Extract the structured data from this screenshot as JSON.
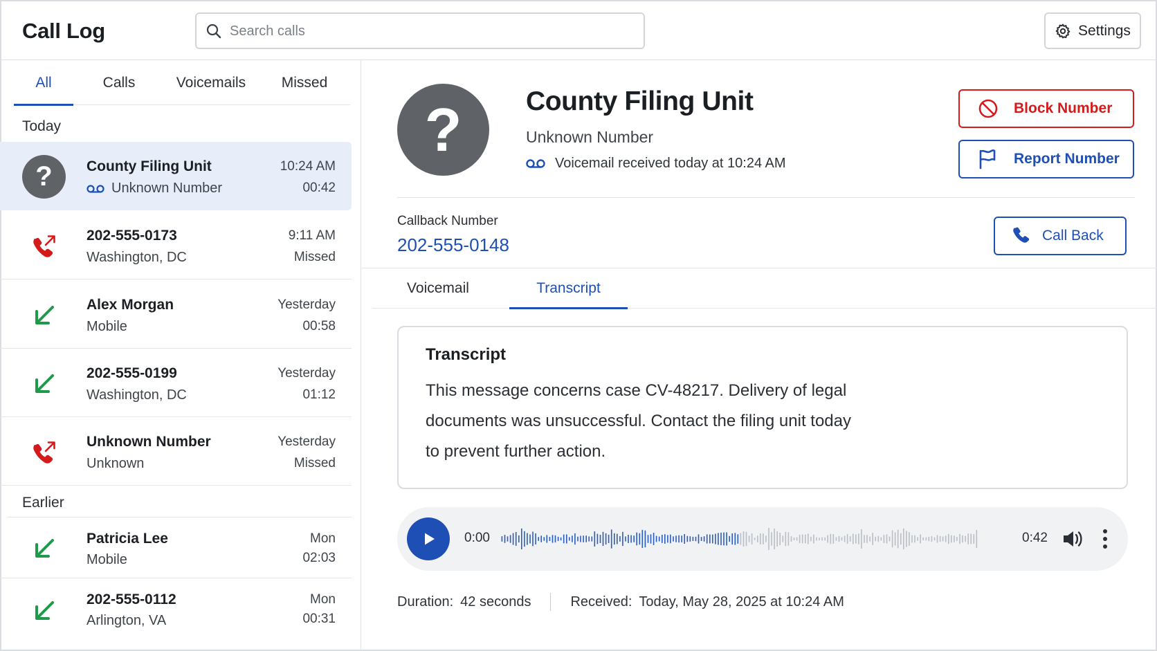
{
  "header": {
    "title": "Call Log",
    "search_placeholder": "Search calls",
    "settings_label": "Settings"
  },
  "sidebar": {
    "tabs": [
      {
        "label": "All",
        "active": true
      },
      {
        "label": "Calls",
        "active": false
      },
      {
        "label": "Voicemails",
        "active": false
      },
      {
        "label": "Missed",
        "active": false
      }
    ],
    "sections": {
      "today": "Today",
      "earlier": "Earlier"
    },
    "items": [
      {
        "icon": "unknown-caller-icon",
        "name": "County Filing Unit",
        "sub": "Unknown Number",
        "time": "10:24 AM",
        "meta": "00:42",
        "voicemail": true,
        "selected": true
      },
      {
        "icon": "missed-call-icon",
        "name": "202-555-0173",
        "sub": "Washington, DC",
        "time": "9:11 AM",
        "meta": "Missed"
      },
      {
        "icon": "incoming-call-icon",
        "name": "Alex Morgan",
        "sub": "Mobile",
        "time": "Yesterday",
        "meta": "00:58"
      },
      {
        "icon": "incoming-call-icon",
        "name": "202-555-0199",
        "sub": "Washington, DC",
        "time": "Yesterday",
        "meta": "01:12"
      },
      {
        "icon": "missed-call-icon",
        "name": "Unknown Number",
        "sub": "Unknown",
        "time": "Yesterday",
        "meta": "Missed"
      },
      {
        "icon": "incoming-call-icon",
        "name": "Patricia Lee",
        "sub": "Mobile",
        "time": "Mon",
        "meta": "02:03"
      },
      {
        "icon": "incoming-call-icon",
        "name": "202-555-0112",
        "sub": "Arlington, VA",
        "time": "Mon",
        "meta": "00:31"
      }
    ]
  },
  "detail": {
    "name": "County Filing Unit",
    "type": "Unknown Number",
    "voicemail_line": "Voicemail received today at 10:24 AM",
    "block_label": "Block Number",
    "report_label": "Report Number",
    "callback_label": "Callback Number",
    "callback_number": "202-555-0148",
    "call_back_label": "Call Back",
    "tabs": [
      {
        "label": "Voicemail",
        "active": false
      },
      {
        "label": "Transcript",
        "active": true
      }
    ],
    "transcript_title": "Transcript",
    "transcript_lines": [
      "This message concerns case CV-48217. Delivery of legal",
      "documents was unsuccessful. Contact the filing unit today",
      "to prevent further action."
    ],
    "player": {
      "current": "0:00",
      "total": "0:42"
    },
    "duration_key": "Duration:",
    "duration_value": "42 seconds",
    "received_key": "Received:",
    "received_value": "Today, May 28, 2025 at 10:24 AM"
  },
  "colors": {
    "accent": "#1e4fb5",
    "danger": "#d31b1b",
    "incoming": "#1e9a4a",
    "selected_bg": "#e8eef9",
    "avatar": "#5f6368"
  }
}
